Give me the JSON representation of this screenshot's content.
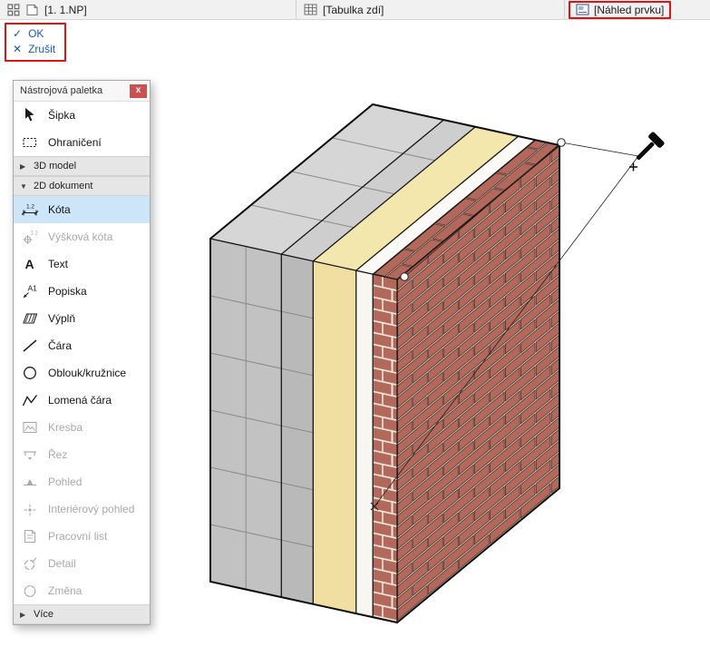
{
  "app": {
    "tabs": [
      {
        "label": "[1. 1.NP]"
      },
      {
        "label": "[Tabulka zdí]"
      },
      {
        "label": "[Náhled prvku]",
        "highlighted": true
      }
    ]
  },
  "confirm": {
    "ok": "OK",
    "cancel": "Zrušit",
    "ok_icon": "✓",
    "cancel_icon": "✕"
  },
  "palette": {
    "title": "Nástrojová paletka",
    "close": "x",
    "items": [
      {
        "label": "Šipka",
        "type": "tool",
        "state": "enabled"
      },
      {
        "label": "Ohraničení",
        "type": "tool",
        "state": "enabled"
      },
      {
        "label": "3D model",
        "type": "section",
        "collapsed": true,
        "glyph": "▶"
      },
      {
        "label": "2D dokument",
        "type": "section",
        "collapsed": false,
        "glyph": "▼"
      },
      {
        "label": "Kóta",
        "type": "tool",
        "state": "selected",
        "icon_text": "1.2"
      },
      {
        "label": "Výšková kóta",
        "type": "tool",
        "state": "disabled",
        "icon_text": "1.2"
      },
      {
        "label": "Text",
        "type": "tool",
        "state": "enabled",
        "icon_text": "A"
      },
      {
        "label": "Popiska",
        "type": "tool",
        "state": "enabled",
        "icon_text": "A1"
      },
      {
        "label": "Výplň",
        "type": "tool",
        "state": "enabled"
      },
      {
        "label": "Čára",
        "type": "tool",
        "state": "enabled"
      },
      {
        "label": "Oblouk/kružnice",
        "type": "tool",
        "state": "enabled"
      },
      {
        "label": "Lomená čára",
        "type": "tool",
        "state": "enabled"
      },
      {
        "label": "Kresba",
        "type": "tool",
        "state": "disabled"
      },
      {
        "label": "Řez",
        "type": "tool",
        "state": "disabled"
      },
      {
        "label": "Pohled",
        "type": "tool",
        "state": "disabled"
      },
      {
        "label": "Interiérový pohled",
        "type": "tool",
        "state": "disabled"
      },
      {
        "label": "Pracovní list",
        "type": "tool",
        "state": "disabled"
      },
      {
        "label": "Detail",
        "type": "tool",
        "state": "disabled"
      },
      {
        "label": "Změna",
        "type": "tool",
        "state": "disabled"
      },
      {
        "label": "Více",
        "type": "section",
        "collapsed": true,
        "glyph": "▶"
      }
    ]
  },
  "canvas": {
    "cursor": "hammer-cursor",
    "active_tool": "Kóta"
  },
  "colors": {
    "annotation_red": "#e01313",
    "action_blue": "#1a57c9",
    "selection_blue_bg": "#cde5f9",
    "close_button_red": "#cd5050",
    "brick": "#b2685a",
    "mortar": "#efe9df",
    "insulation_yellow": "#f0dfa0",
    "concrete_gray": "#c2c2c2"
  }
}
